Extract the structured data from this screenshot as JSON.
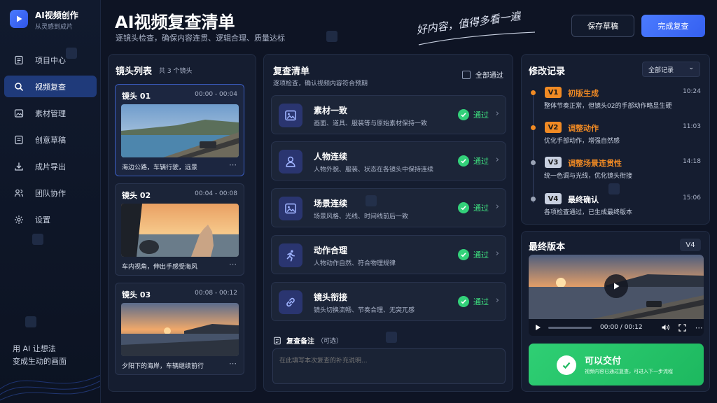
{
  "app": {
    "name": "AI视频创作",
    "tagline": "从灵感到成片"
  },
  "nav": [
    {
      "label": "项目中心",
      "icon": "document-icon"
    },
    {
      "label": "视频复查",
      "icon": "search-icon",
      "active": true
    },
    {
      "label": "素材管理",
      "icon": "image-icon"
    },
    {
      "label": "创意草稿",
      "icon": "draft-icon"
    },
    {
      "label": "成片导出",
      "icon": "download-icon"
    },
    {
      "label": "团队协作",
      "icon": "team-icon"
    },
    {
      "label": "设置",
      "icon": "gear-icon"
    }
  ],
  "slogan": [
    "用 AI 让想法",
    "变成生动的画面"
  ],
  "header": {
    "title": "AI视频复查清单",
    "subtitle": "逐镜头检查，确保内容连贯、逻辑合理、质量达标",
    "handwriting": "好内容，值得多看一遍",
    "save_draft": "保存草稿",
    "finish_review": "完成复查"
  },
  "shots": {
    "title": "镜头列表",
    "count": "共 3 个镜头",
    "items": [
      {
        "name": "镜头 01",
        "time": "00:00 - 00:04",
        "caption": "海边公路，车辆行驶，远景"
      },
      {
        "name": "镜头 02",
        "time": "00:04 - 00:08",
        "caption": "车内视角，伸出手感受海风"
      },
      {
        "name": "镜头 03",
        "time": "00:08 - 00:12",
        "caption": "夕阳下的海岸，车辆继续前行"
      }
    ]
  },
  "checklist": {
    "title": "复查清单",
    "subtitle": "逐项检查，确认视频内容符合预期",
    "select_all": "全部通过",
    "items": [
      {
        "title": "素材一致",
        "desc": "画面、道具、服装等与原始素材保持一致",
        "status": "通过",
        "icon": "image-icon"
      },
      {
        "title": "人物连续",
        "desc": "人物外貌、服装、状态在各镜头中保持连续",
        "status": "通过",
        "icon": "person-icon"
      },
      {
        "title": "场景连续",
        "desc": "场景风格、光线、时间线前后一致",
        "status": "通过",
        "icon": "image-icon"
      },
      {
        "title": "动作合理",
        "desc": "人物动作自然、符合物理规律",
        "status": "通过",
        "icon": "run-icon"
      },
      {
        "title": "镜头衔接",
        "desc": "镜头切换流畅、节奏合理、无突兀感",
        "status": "通过",
        "icon": "link-icon"
      }
    ],
    "notes_label": "复查备注",
    "notes_optional": "（可选）",
    "notes_placeholder": "在此填写本次复查的补充说明..."
  },
  "history": {
    "title": "修改记录",
    "filter": "全部记录",
    "items": [
      {
        "ver": "V1",
        "title": "初版生成",
        "time": "10:24",
        "desc": "整体节奏正常，但镜头02的手部动作略显生硬",
        "color": "#f08a24"
      },
      {
        "ver": "V2",
        "title": "调整动作",
        "time": "11:03",
        "desc": "优化手部动作，增强自然感",
        "color": "#f08a24"
      },
      {
        "ver": "V3",
        "title": "调整场景连贯性",
        "time": "14:18",
        "desc": "统一色调与光线，优化镜头衔接",
        "color": "#9aa3b5"
      },
      {
        "ver": "V4",
        "title": "最终确认",
        "time": "15:06",
        "desc": "各项检查通过，已生成最终版本",
        "color": "#9aa3b5"
      }
    ]
  },
  "final": {
    "title": "最终版本",
    "version": "V4",
    "time": "00:00 / 00:12",
    "progress": 0.0
  },
  "deliver": {
    "title": "可以交付",
    "desc": "视频内容已通过复查，可进入下一步流程"
  }
}
